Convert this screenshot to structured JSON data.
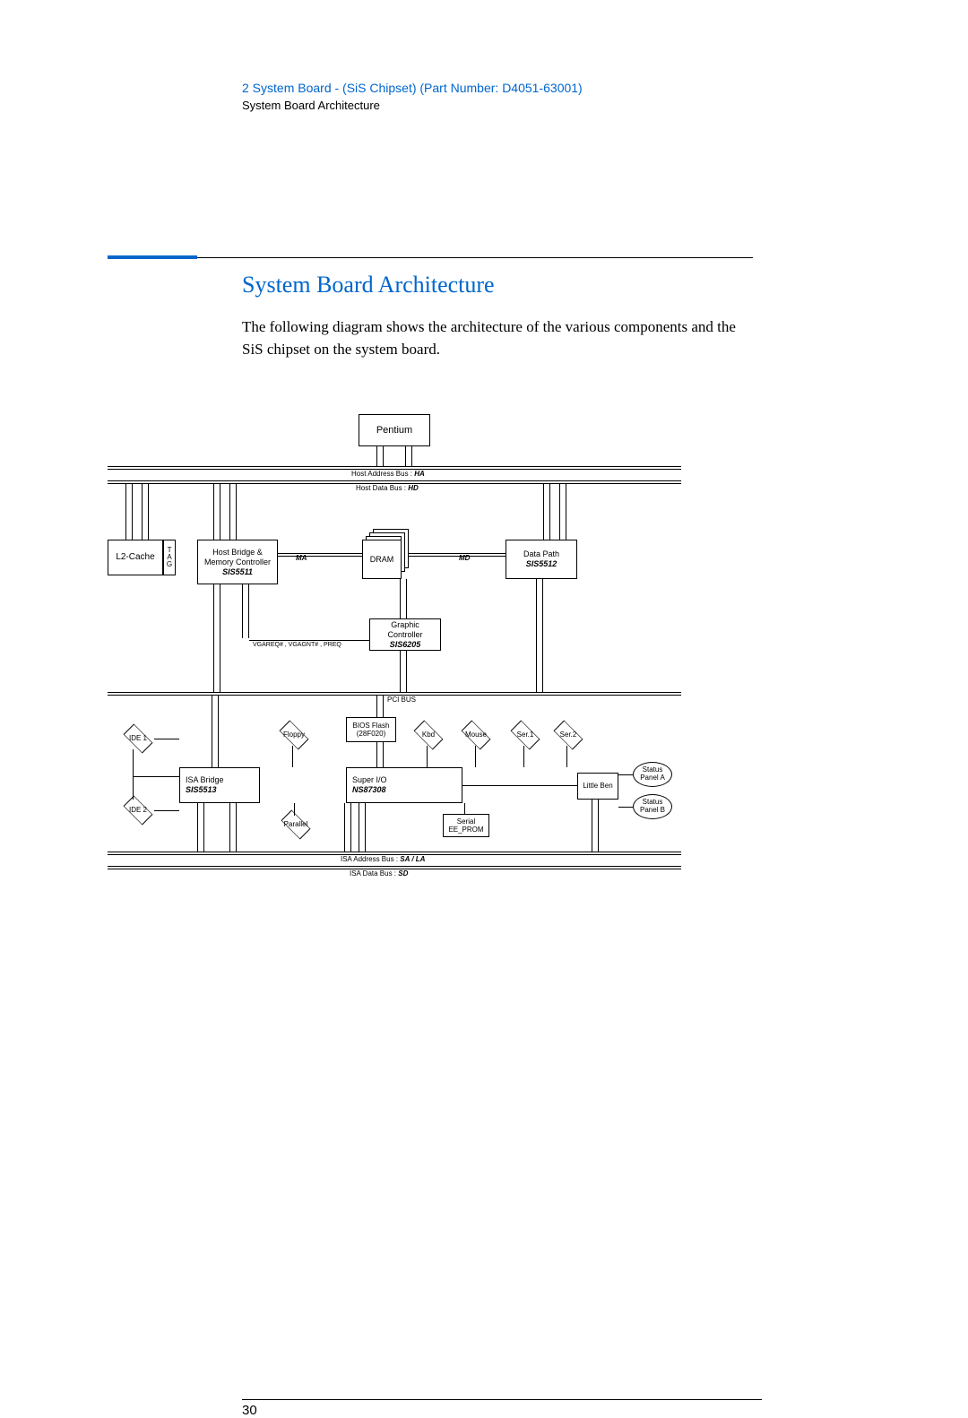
{
  "header": {
    "chapter": "2   System Board - (SiS Chipset) (Part Number: D4051-63001)",
    "subtitle": "System Board Architecture"
  },
  "section": {
    "title": "System Board Architecture",
    "body": "The following diagram shows the architecture of the various components and the SiS chipset on the system board."
  },
  "page_number": "30",
  "diagram": {
    "cpu": "Pentium",
    "bus_ha_label": "Host Address Bus :",
    "bus_ha_name": "HA",
    "bus_hd_label": "Host Data Bus :",
    "bus_hd_name": "HD",
    "l2_cache": "L2-Cache",
    "tag": "T\nA\nG",
    "host_bridge_line1": "Host Bridge &",
    "host_bridge_line2": "Memory Controller",
    "host_bridge_chip": "SIS5511",
    "ma_label": "MA",
    "md_label": "MD",
    "dram": "DRAM",
    "data_path_line1": "Data Path",
    "data_path_chip": "SIS5512",
    "graphic_line1": "Graphic Controller",
    "graphic_chip": "SIS6205",
    "vga_signal": "VGAREQ# , VGAGNT# , PREQ",
    "pci_bus": "PCI BUS",
    "ide1": "IDE 1",
    "ide2": "IDE 2",
    "isa_bridge_line1": "ISA Bridge",
    "isa_bridge_chip": "SIS5513",
    "floppy": "Floppy",
    "bios_line1": "BIOS Flash",
    "bios_line2": "(28F020)",
    "kbd": "Kbd",
    "mouse": "Mouse",
    "ser1": "Ser.1",
    "ser2": "Ser.2",
    "super_io_line1": "Super I/O",
    "super_io_chip": "NS87308",
    "parallel": "Parallel",
    "serial_eeprom_line1": "Serial",
    "serial_eeprom_line2": "EE_PROM",
    "little_ben": "Little Ben",
    "status_a_line1": "Status",
    "status_a_line2": "Panel A",
    "status_b_line1": "Status",
    "status_b_line2": "Panel B",
    "isa_addr_label": "ISA Address Bus :",
    "isa_addr_name": "SA / LA",
    "isa_data_label": "ISA Data Bus :",
    "isa_data_name": "SD"
  }
}
